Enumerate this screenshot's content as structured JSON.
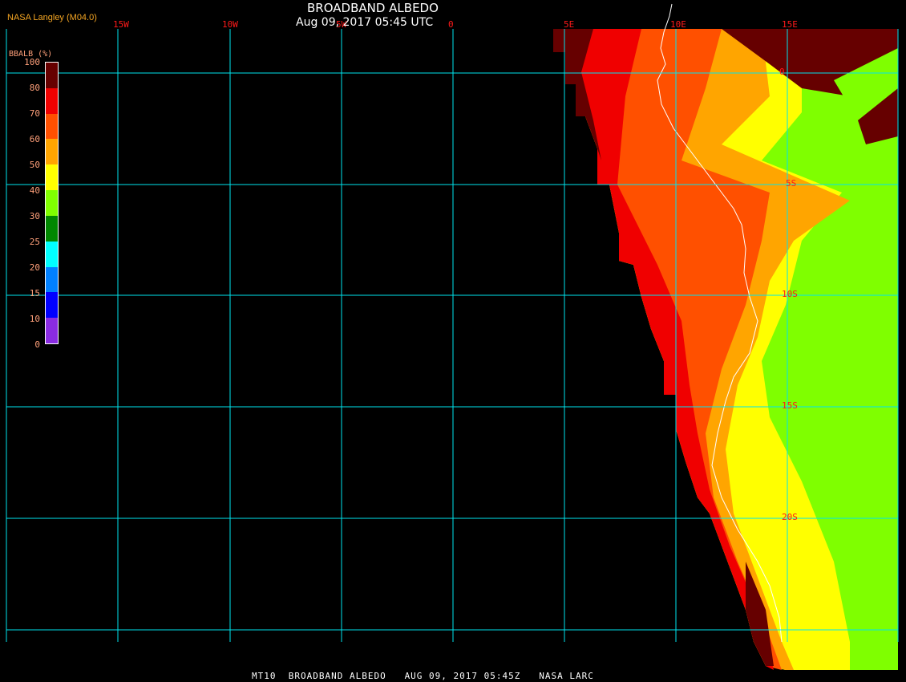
{
  "header": {
    "title": "BROADBAND ALBEDO",
    "datetime": "Aug 09, 2017 05:45 UTC",
    "source": "NASA Langley (M04.0)"
  },
  "longitude_labels": [
    "15W",
    "10W",
    "5W",
    "0",
    "5E",
    "10E",
    "15E"
  ],
  "latitude_labels": [
    "0",
    "5S",
    "10S",
    "15S",
    "20S"
  ],
  "legend": {
    "title": "BBALB (%)",
    "ticks": [
      "100",
      "80",
      "70",
      "60",
      "50",
      "40",
      "30",
      "25",
      "20",
      "15",
      "10",
      "0"
    ],
    "colors": [
      "#660000",
      "#f00000",
      "#ff5000",
      "#ffa500",
      "#ffff00",
      "#80ff00",
      "#008800",
      "#00ffff",
      "#0080ff",
      "#0000ff",
      "#8a2be2"
    ]
  },
  "footer": "MT10  BROADBAND ALBEDO   AUG 09, 2017 05:45Z   NASA LARC",
  "colors": {
    "grid": "#00e5ee",
    "labels": "#ff1a1a"
  }
}
